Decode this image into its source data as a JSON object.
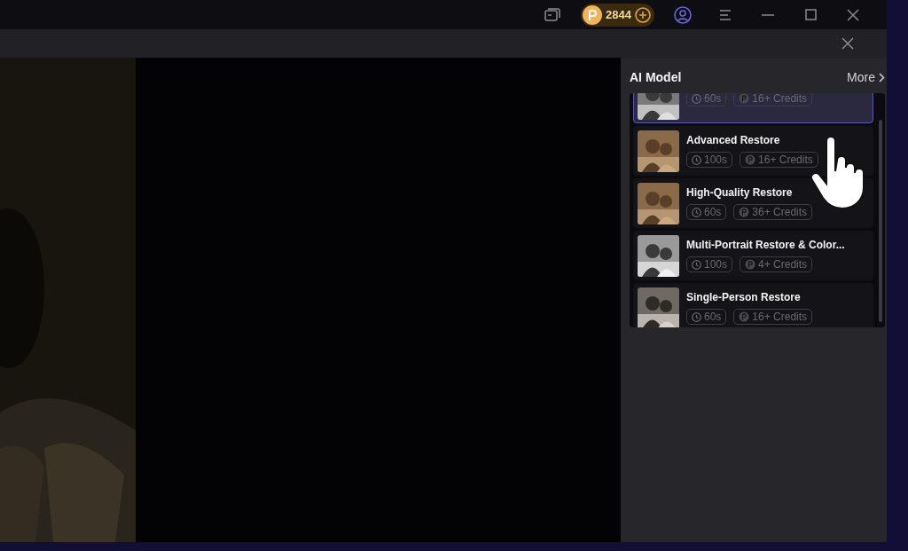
{
  "title_bar": {
    "credits": "2844"
  },
  "model_panel": {
    "title": "AI Model",
    "more": "More",
    "models": [
      {
        "duration": "60s",
        "credits": "16+ Credits",
        "selected": true
      },
      {
        "name": "Advanced Restore",
        "duration": "100s",
        "credits": "16+ Credits",
        "selected": false
      },
      {
        "name": "High-Quality Restore",
        "duration": "60s",
        "credits": "36+ Credits",
        "selected": false
      },
      {
        "name": "Multi-Portrait Restore & Color...",
        "duration": "100s",
        "credits": "4+ Credits",
        "selected": false
      },
      {
        "name": "Single-Person Restore",
        "duration": "60s",
        "credits": "16+ Credits",
        "selected": false
      }
    ]
  }
}
